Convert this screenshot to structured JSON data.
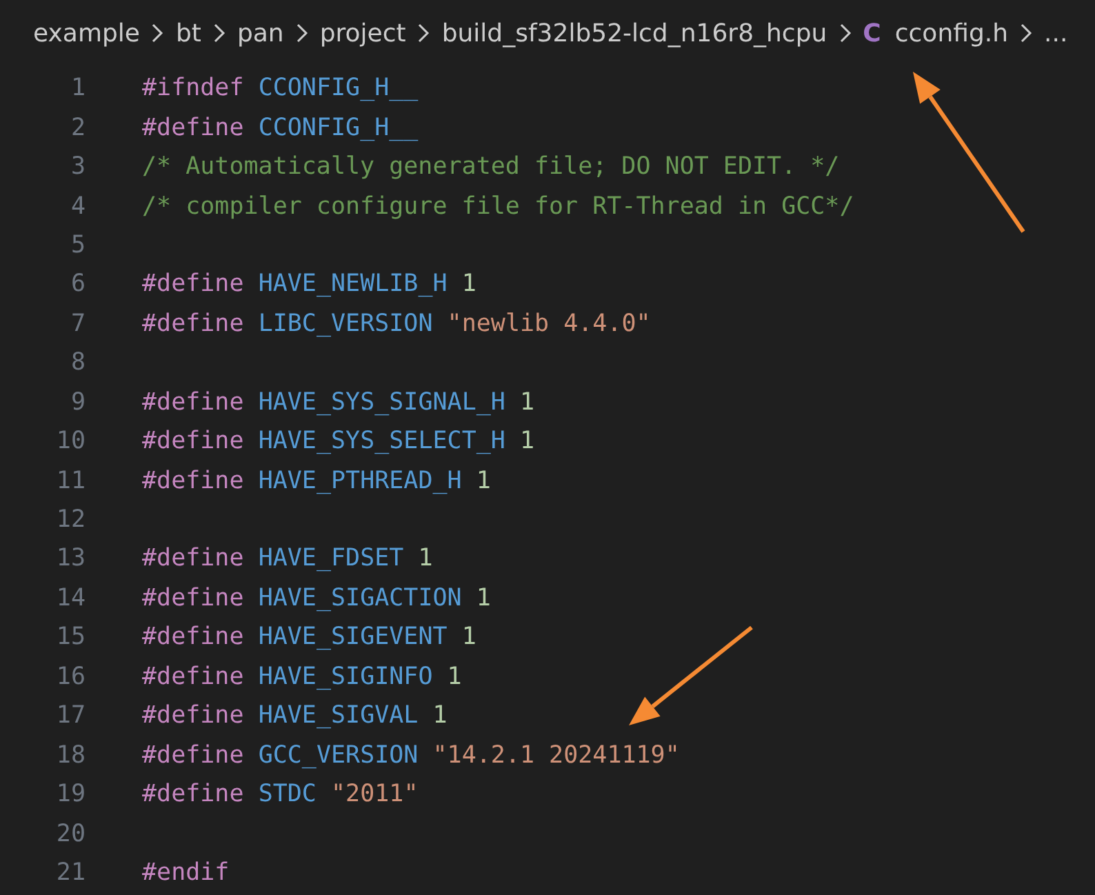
{
  "breadcrumb": {
    "items": [
      {
        "kind": "folder",
        "label": "example"
      },
      {
        "kind": "folder",
        "label": "bt"
      },
      {
        "kind": "folder",
        "label": "pan"
      },
      {
        "kind": "folder",
        "label": "project"
      },
      {
        "kind": "folder",
        "label": "build_sf32lb52-lcd_n16r8_hcpu"
      },
      {
        "kind": "file",
        "icon": "C",
        "label": "cconfig.h"
      },
      {
        "kind": "more",
        "label": "..."
      }
    ]
  },
  "editor": {
    "lines": [
      {
        "number": "1",
        "tokens": [
          {
            "kind": "directive",
            "text": "#ifndef"
          },
          {
            "kind": "macro",
            "text": "CCONFIG_H__"
          }
        ]
      },
      {
        "number": "2",
        "tokens": [
          {
            "kind": "directive",
            "text": "#define"
          },
          {
            "kind": "macro",
            "text": "CCONFIG_H__"
          }
        ]
      },
      {
        "number": "3",
        "tokens": [
          {
            "kind": "comment",
            "text": "/* Automatically generated file; DO NOT EDIT. */"
          }
        ]
      },
      {
        "number": "4",
        "tokens": [
          {
            "kind": "comment",
            "text": "/* compiler configure file for RT-Thread in GCC*/"
          }
        ]
      },
      {
        "number": "5"
      },
      {
        "number": "6",
        "tokens": [
          {
            "kind": "directive",
            "text": "#define"
          },
          {
            "kind": "macro",
            "text": "HAVE_NEWLIB_H"
          },
          {
            "kind": "number",
            "text": "1"
          }
        ]
      },
      {
        "number": "7",
        "tokens": [
          {
            "kind": "directive",
            "text": "#define"
          },
          {
            "kind": "macro",
            "text": "LIBC_VERSION"
          },
          {
            "kind": "string",
            "text": "\"newlib 4.4.0\""
          }
        ]
      },
      {
        "number": "8"
      },
      {
        "number": "9",
        "tokens": [
          {
            "kind": "directive",
            "text": "#define"
          },
          {
            "kind": "macro",
            "text": "HAVE_SYS_SIGNAL_H"
          },
          {
            "kind": "number",
            "text": "1"
          }
        ]
      },
      {
        "number": "10",
        "tokens": [
          {
            "kind": "directive",
            "text": "#define"
          },
          {
            "kind": "macro",
            "text": "HAVE_SYS_SELECT_H"
          },
          {
            "kind": "number",
            "text": "1"
          }
        ]
      },
      {
        "number": "11",
        "tokens": [
          {
            "kind": "directive",
            "text": "#define"
          },
          {
            "kind": "macro",
            "text": "HAVE_PTHREAD_H"
          },
          {
            "kind": "number",
            "text": "1"
          }
        ]
      },
      {
        "number": "12"
      },
      {
        "number": "13",
        "tokens": [
          {
            "kind": "directive",
            "text": "#define"
          },
          {
            "kind": "macro",
            "text": "HAVE_FDSET"
          },
          {
            "kind": "number",
            "text": "1"
          }
        ]
      },
      {
        "number": "14",
        "tokens": [
          {
            "kind": "directive",
            "text": "#define"
          },
          {
            "kind": "macro",
            "text": "HAVE_SIGACTION"
          },
          {
            "kind": "number",
            "text": "1"
          }
        ]
      },
      {
        "number": "15",
        "tokens": [
          {
            "kind": "directive",
            "text": "#define"
          },
          {
            "kind": "macro",
            "text": "HAVE_SIGEVENT"
          },
          {
            "kind": "number",
            "text": "1"
          }
        ]
      },
      {
        "number": "16",
        "tokens": [
          {
            "kind": "directive",
            "text": "#define"
          },
          {
            "kind": "macro",
            "text": "HAVE_SIGINFO"
          },
          {
            "kind": "number",
            "text": "1"
          }
        ]
      },
      {
        "number": "17",
        "tokens": [
          {
            "kind": "directive",
            "text": "#define"
          },
          {
            "kind": "macro",
            "text": "HAVE_SIGVAL"
          },
          {
            "kind": "number",
            "text": "1"
          }
        ]
      },
      {
        "number": "18",
        "tokens": [
          {
            "kind": "directive",
            "text": "#define"
          },
          {
            "kind": "macro",
            "text": "GCC_VERSION"
          },
          {
            "kind": "string",
            "text": "\"14.2.1 20241119\""
          }
        ]
      },
      {
        "number": "19",
        "tokens": [
          {
            "kind": "directive",
            "text": "#define"
          },
          {
            "kind": "macro",
            "text": "STDC"
          },
          {
            "kind": "string",
            "text": "\"2011\""
          }
        ]
      },
      {
        "number": "20"
      },
      {
        "number": "21",
        "tokens": [
          {
            "kind": "directive",
            "text": "#endif"
          }
        ]
      }
    ]
  },
  "annotations": [
    {
      "kind": "arrow"
    },
    {
      "kind": "arrow"
    }
  ]
}
